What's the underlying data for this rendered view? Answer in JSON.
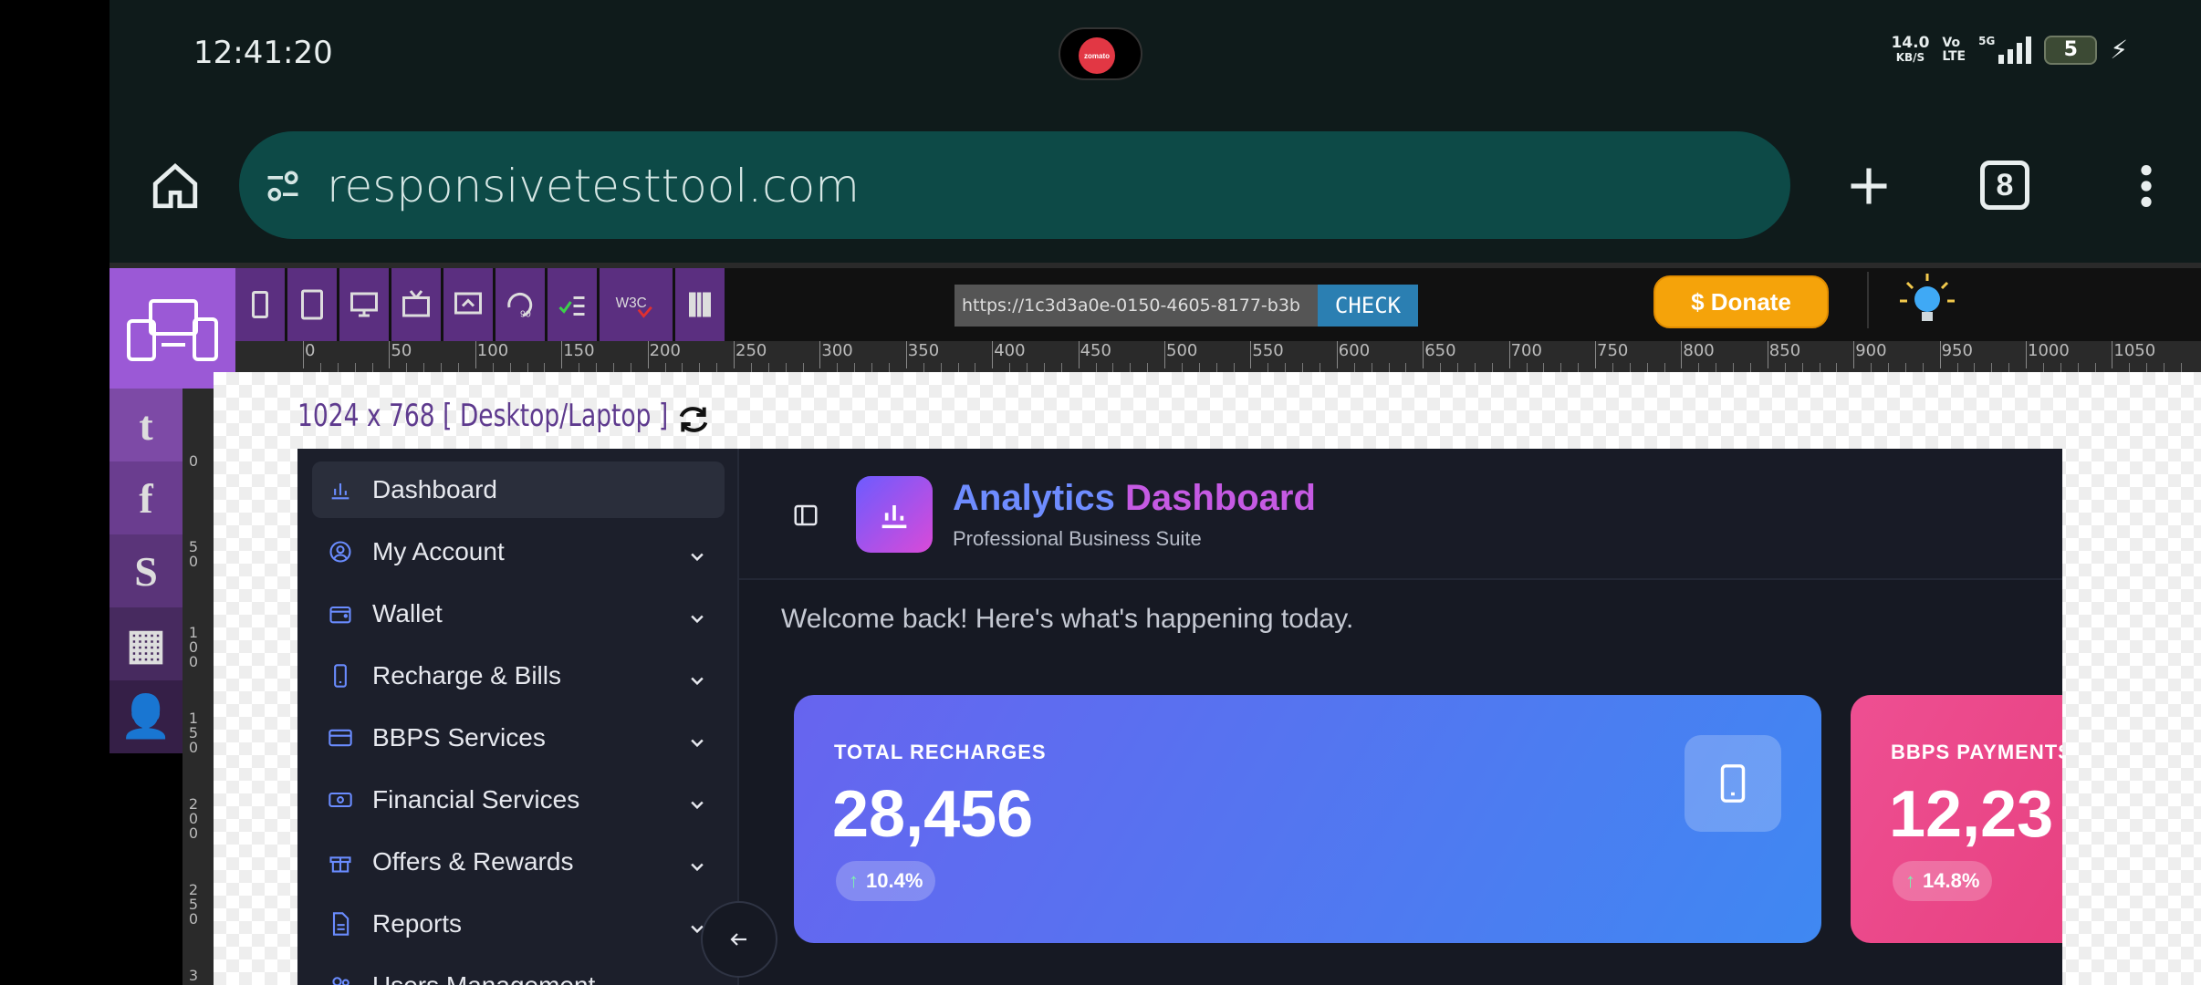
{
  "status_bar": {
    "time": "12:41:20",
    "camera_app": "zomato",
    "net_speed": "14.0",
    "net_unit": "KB/S",
    "volte_top": "Vo",
    "volte_bottom": "LTE",
    "network": "5G",
    "battery": "5"
  },
  "browser": {
    "url": "responsivetesttool.com",
    "tab_count": "8"
  },
  "tool": {
    "url_value": "https://1c3d3a0e-0150-4605-8177-b3b",
    "check_label": "CHECK",
    "donate_label": "$ Donate",
    "viewport_label": "1024 x 768 [ Desktop/Laptop ]",
    "ruler_top": [
      "0",
      "50",
      "100",
      "150",
      "200",
      "250",
      "300",
      "350",
      "400",
      "450",
      "500",
      "550",
      "600",
      "650",
      "700",
      "750",
      "800",
      "850",
      "900",
      "950",
      "1000",
      "1050"
    ],
    "ruler_left": [
      "0",
      "50",
      "100",
      "150",
      "200",
      "250",
      "3"
    ]
  },
  "dashboard": {
    "nav": [
      {
        "label": "Dashboard",
        "icon": "bar-chart-icon"
      },
      {
        "label": "My Account",
        "icon": "user-circle-icon"
      },
      {
        "label": "Wallet",
        "icon": "wallet-icon"
      },
      {
        "label": "Recharge & Bills",
        "icon": "phone-icon"
      },
      {
        "label": "BBPS Services",
        "icon": "credit-card-icon"
      },
      {
        "label": "Financial Services",
        "icon": "banknote-icon"
      },
      {
        "label": "Offers & Rewards",
        "icon": "gift-icon"
      },
      {
        "label": "Reports",
        "icon": "file-text-icon"
      },
      {
        "label": "Users Management",
        "icon": "users-icon"
      }
    ],
    "brand_title_part1": "Analytics",
    "brand_title_part2": "Dashboard",
    "brand_subtitle": "Professional Business Suite",
    "welcome": "Welcome back! Here's what's happening today.",
    "cards": [
      {
        "label": "TOTAL RECHARGES",
        "value": "28,456",
        "change": "10.4%",
        "color": "#5b7cf0"
      },
      {
        "label": "BBPS PAYMENTS",
        "value": "12,23",
        "change": "14.8%",
        "color": "#ec4a8a"
      }
    ]
  }
}
